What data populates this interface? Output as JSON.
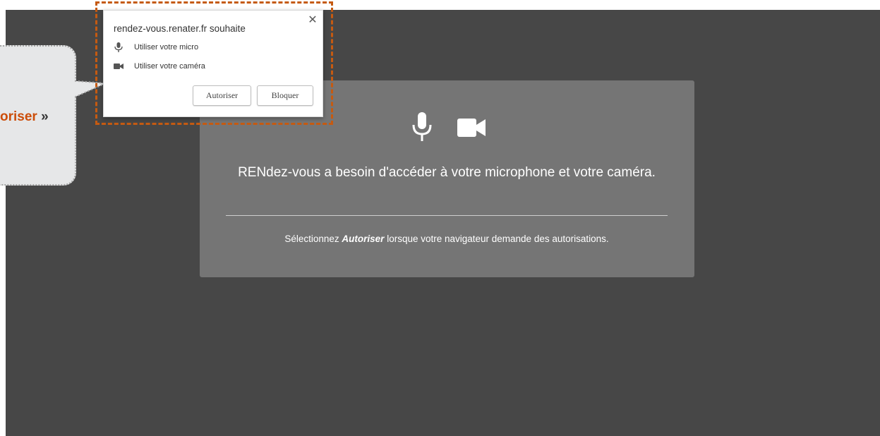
{
  "colors": {
    "app_background": "#474747",
    "panel_background": "#757575",
    "highlight": "#c55a11",
    "callout_background": "#e6e7e8",
    "callout_accent": "#cc4d09"
  },
  "callout": {
    "text_accent": "oriser",
    "text_suffix": " »"
  },
  "popup": {
    "title": "rendez-vous.renater.fr souhaite",
    "close_icon": "✕",
    "permissions": [
      {
        "icon": "microphone-icon",
        "label": "Utiliser votre micro"
      },
      {
        "icon": "camera-icon",
        "label": "Utiliser votre caméra"
      }
    ],
    "allow_label": "Autoriser",
    "block_label": "Bloquer"
  },
  "panel": {
    "icons": [
      "microphone-icon",
      "camera-icon"
    ],
    "message": "RENdez-vous a besoin d'accéder à votre microphone et votre caméra.",
    "instruction_prefix": "Sélectionnez ",
    "instruction_emphasis": "Autoriser",
    "instruction_suffix": " lorsque votre navigateur demande des autorisations."
  }
}
